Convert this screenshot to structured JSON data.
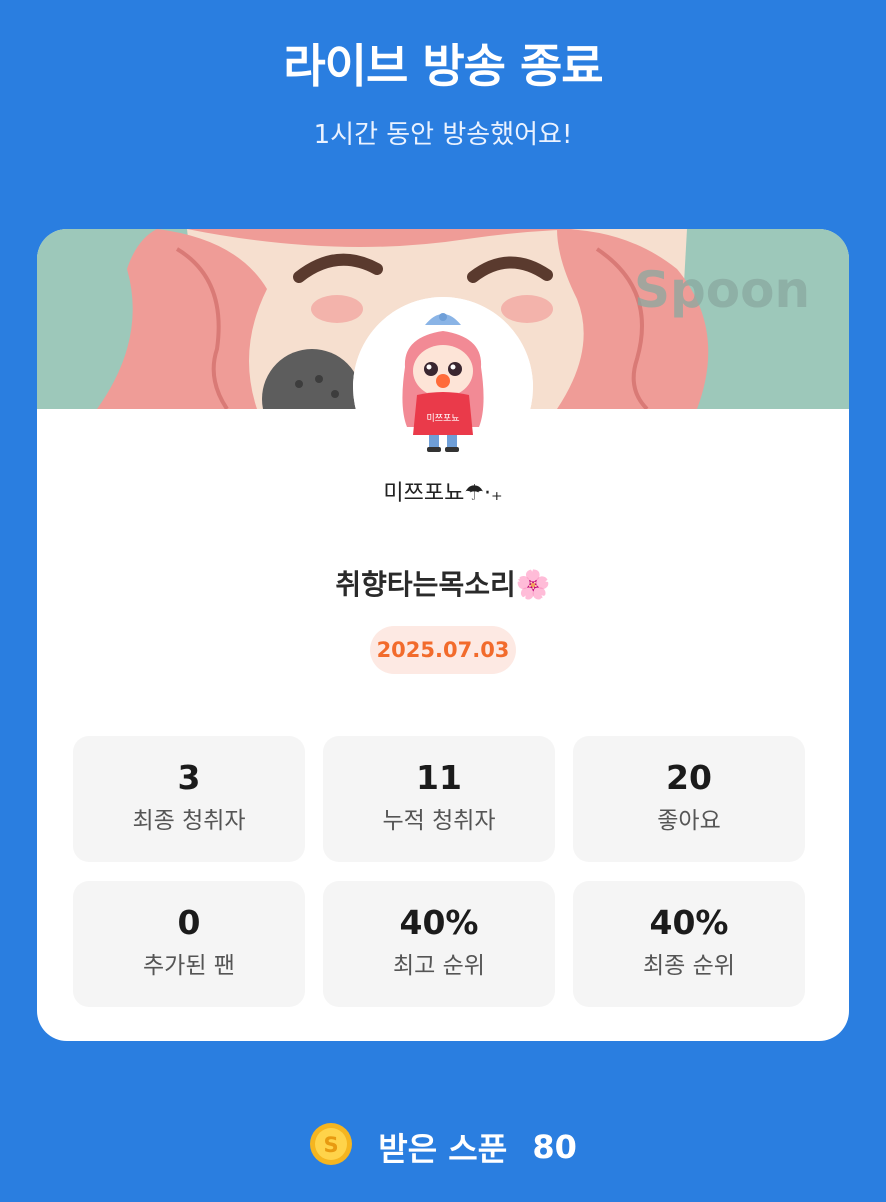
{
  "header": {
    "title": "라이브 방송 종료",
    "subtitle": "1시간 동안 방송했어요!"
  },
  "card": {
    "banner_watermark": "Spoon",
    "avatar_shirt_text": "미쯔포뇨",
    "username": "미쯔포뇨☂︎·₊",
    "broadcast_title": "취향타는목소리🌸",
    "date": "2025.07.03",
    "stats": [
      {
        "value": "3",
        "label": "최종 청취자"
      },
      {
        "value": "11",
        "label": "누적 청취자"
      },
      {
        "value": "20",
        "label": "좋아요"
      },
      {
        "value": "0",
        "label": "추가된 팬"
      },
      {
        "value": "40%",
        "label": "최고 순위"
      },
      {
        "value": "40%",
        "label": "최종 순위"
      }
    ]
  },
  "footer": {
    "coin_icon": "spoon-coin-icon",
    "coin_letter": "S",
    "label": "받은 스푼",
    "count": "80"
  },
  "colors": {
    "background": "#2a7ee0",
    "date_text": "#f26b2c",
    "date_bg": "#fde9e3",
    "stat_bg": "#f5f5f5"
  }
}
